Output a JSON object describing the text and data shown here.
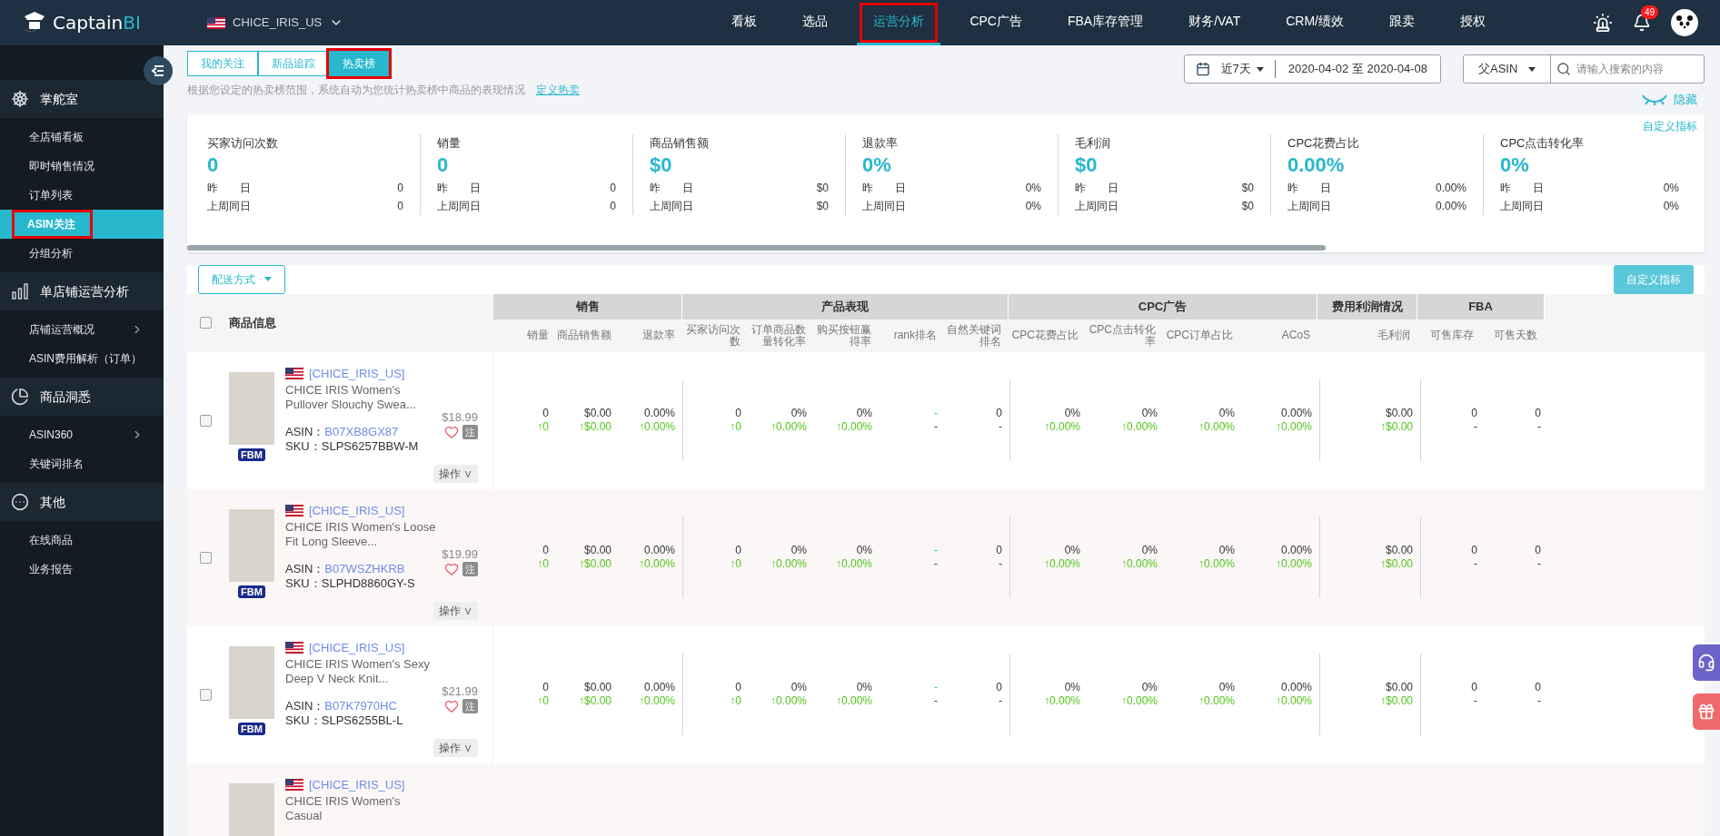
{
  "header": {
    "logo": {
      "name": "Captain",
      "accent": "BI"
    },
    "store": "CHICE_IRIS_US",
    "notification_count": "49",
    "nav": [
      {
        "label": "看板",
        "selected": false
      },
      {
        "label": "选品",
        "selected": false
      },
      {
        "label": "运营分析",
        "selected": true
      },
      {
        "label": "CPC广告",
        "selected": false
      },
      {
        "label": "FBA库存管理",
        "selected": false
      },
      {
        "label": "财务/VAT",
        "selected": false
      },
      {
        "label": "CRM/绩效",
        "selected": false
      },
      {
        "label": "跟卖",
        "selected": false
      },
      {
        "label": "授权",
        "selected": false
      }
    ]
  },
  "sidebar": {
    "sections": [
      {
        "title": "掌舵室",
        "items": [
          {
            "label": "全店铺看板",
            "selected": false,
            "has_submenu": false
          },
          {
            "label": "即时销售情况",
            "selected": false,
            "has_submenu": false
          },
          {
            "label": "订单列表",
            "selected": false,
            "has_submenu": false
          },
          {
            "label": "ASIN关注",
            "selected": true,
            "has_submenu": false
          },
          {
            "label": "分组分析",
            "selected": false,
            "has_submenu": false
          }
        ]
      },
      {
        "title": "单店铺运营分析",
        "items": [
          {
            "label": "店铺运营概况",
            "selected": false,
            "has_submenu": true
          },
          {
            "label": "ASIN费用解析（订单）",
            "selected": false,
            "has_submenu": false
          }
        ]
      },
      {
        "title": "商品洞悉",
        "items": [
          {
            "label": "ASIN360",
            "selected": false,
            "has_submenu": true
          },
          {
            "label": "关键词排名",
            "selected": false,
            "has_submenu": false
          }
        ]
      },
      {
        "title": "其他",
        "items": [
          {
            "label": "在线商品",
            "selected": false,
            "has_submenu": false
          },
          {
            "label": "业务报告",
            "selected": false,
            "has_submenu": false
          }
        ]
      }
    ]
  },
  "tabs": [
    {
      "label": "我的关注",
      "selected": false
    },
    {
      "label": "新品追踪",
      "selected": false
    },
    {
      "label": "热卖榜",
      "selected": true
    }
  ],
  "hint": "根据您设定的热卖榜范围，系统自动为您统计热卖榜中商品的表现情况",
  "hint_link": "定义热卖",
  "date_filter": {
    "preset": "近7天",
    "range": "2020-04-02 至 2020-04-08"
  },
  "search": {
    "scope": "父ASIN",
    "placeholder": "请输入搜索的内容"
  },
  "hide_label": "隐藏",
  "customize_link": "自定义指标",
  "metrics": [
    {
      "label": "买家访问次数",
      "value": "0",
      "compare": [
        {
          "label": "昨　　日",
          "value": "0"
        },
        {
          "label": "上周同日",
          "value": "0"
        }
      ]
    },
    {
      "label": "销量",
      "value": "0",
      "compare": [
        {
          "label": "昨　　日",
          "value": "0"
        },
        {
          "label": "上周同日",
          "value": "0"
        }
      ]
    },
    {
      "label": "商品销售额",
      "value": "$0",
      "compare": [
        {
          "label": "昨　　日",
          "value": "$0"
        },
        {
          "label": "上周同日",
          "value": "$0"
        }
      ]
    },
    {
      "label": "退款率",
      "value": "0%",
      "compare": [
        {
          "label": "昨　　日",
          "value": "0%"
        },
        {
          "label": "上周同日",
          "value": "0%"
        }
      ]
    },
    {
      "label": "毛利润",
      "value": "$0",
      "compare": [
        {
          "label": "昨　　日",
          "value": "$0"
        },
        {
          "label": "上周同日",
          "value": "$0"
        }
      ]
    },
    {
      "label": "CPC花费占比",
      "value": "0.00%",
      "compare": [
        {
          "label": "昨　　日",
          "value": "0.00%"
        },
        {
          "label": "上周同日",
          "value": "0.00%"
        }
      ]
    },
    {
      "label": "CPC点击转化率",
      "value": "0%",
      "compare": [
        {
          "label": "昨　　日",
          "value": "0%"
        },
        {
          "label": "上周同日",
          "value": "0%"
        }
      ]
    }
  ],
  "table": {
    "delivery_filter": "配送方式",
    "customize_button": "自定义指标",
    "select_all": false,
    "product_header": "商品信息",
    "groups": [
      {
        "label": "销售",
        "columns": [
          "销量",
          "商品销售额",
          "退款率"
        ]
      },
      {
        "label": "产品表现",
        "columns": [
          "买家访问次数",
          "订单商品数量转化率",
          "购买按钮赢得率",
          "rank排名",
          "自然关键词排名"
        ]
      },
      {
        "label": "CPC广告",
        "columns": [
          "CPC花费占比",
          "CPC点击转化率",
          "CPC订单占比",
          "ACoS"
        ]
      },
      {
        "label": "费用利润情况",
        "columns": [
          "毛利润"
        ]
      },
      {
        "label": "FBA",
        "columns": [
          "可售库存",
          "可售天数"
        ]
      }
    ],
    "rows": [
      {
        "checked": false,
        "store": "[CHICE_IRIS_US]",
        "title": "CHICE IRIS Women's Pullover Slouchy Swea...",
        "price": "$18.99",
        "asin_label": "ASIN：",
        "asin": "B07XB8GX87",
        "sku_label": "SKU：",
        "sku": "SLPS6257BBW-M",
        "fulfillment": "FBM",
        "note": "注",
        "action": "操作 ∨",
        "cells": [
          {
            "kind": "rise",
            "value": "0",
            "change": "↑0"
          },
          {
            "kind": "rise",
            "value": "$0.00",
            "change": "↑$0.00"
          },
          {
            "kind": "rise",
            "value": "0.00%",
            "change": "↑0.00%"
          },
          {
            "kind": "rise",
            "value": "0",
            "change": "↑0"
          },
          {
            "kind": "rise",
            "value": "0%",
            "change": "↑0.00%"
          },
          {
            "kind": "rise",
            "value": "0%",
            "change": "↑0.00%"
          },
          {
            "kind": "rank",
            "value": "-",
            "change": "-"
          },
          {
            "kind": "plain",
            "value": "0",
            "change": "-"
          },
          {
            "kind": "rise",
            "value": "0%",
            "change": "↑0.00%"
          },
          {
            "kind": "rise",
            "value": "0%",
            "change": "↑0.00%"
          },
          {
            "kind": "rise",
            "value": "0%",
            "change": "↑0.00%"
          },
          {
            "kind": "rise",
            "value": "0.00%",
            "change": "↑0.00%"
          },
          {
            "kind": "rise",
            "value": "$0.00",
            "change": "↑$0.00"
          },
          {
            "kind": "plain",
            "value": "0",
            "change": "-"
          },
          {
            "kind": "plain",
            "value": "0",
            "change": "-"
          }
        ]
      },
      {
        "checked": false,
        "store": "[CHICE_IRIS_US]",
        "title": "CHICE IRIS Women's Loose Fit Long Sleeve...",
        "price": "$19.99",
        "asin_label": "ASIN：",
        "asin": "B07WSZHKRB",
        "sku_label": "SKU：",
        "sku": "SLPHD8860GY-S",
        "fulfillment": "FBM",
        "note": "注",
        "action": "操作 ∨",
        "cells": [
          {
            "kind": "rise",
            "value": "0",
            "change": "↑0"
          },
          {
            "kind": "rise",
            "value": "$0.00",
            "change": "↑$0.00"
          },
          {
            "kind": "rise",
            "value": "0.00%",
            "change": "↑0.00%"
          },
          {
            "kind": "rise",
            "value": "0",
            "change": "↑0"
          },
          {
            "kind": "rise",
            "value": "0%",
            "change": "↑0.00%"
          },
          {
            "kind": "rise",
            "value": "0%",
            "change": "↑0.00%"
          },
          {
            "kind": "rank",
            "value": "-",
            "change": "-"
          },
          {
            "kind": "plain",
            "value": "0",
            "change": "-"
          },
          {
            "kind": "rise",
            "value": "0%",
            "change": "↑0.00%"
          },
          {
            "kind": "rise",
            "value": "0%",
            "change": "↑0.00%"
          },
          {
            "kind": "rise",
            "value": "0%",
            "change": "↑0.00%"
          },
          {
            "kind": "rise",
            "value": "0.00%",
            "change": "↑0.00%"
          },
          {
            "kind": "rise",
            "value": "$0.00",
            "change": "↑$0.00"
          },
          {
            "kind": "plain",
            "value": "0",
            "change": "-"
          },
          {
            "kind": "plain",
            "value": "0",
            "change": "-"
          }
        ]
      },
      {
        "checked": false,
        "store": "[CHICE_IRIS_US]",
        "title": "CHICE IRIS Women's Sexy Deep V Neck Knit...",
        "price": "$21.99",
        "asin_label": "ASIN：",
        "asin": "B07K7970HC",
        "sku_label": "SKU：",
        "sku": "SLPS6255BL-L",
        "fulfillment": "FBM",
        "note": "注",
        "action": "操作 ∨",
        "cells": [
          {
            "kind": "rise",
            "value": "0",
            "change": "↑0"
          },
          {
            "kind": "rise",
            "value": "$0.00",
            "change": "↑$0.00"
          },
          {
            "kind": "rise",
            "value": "0.00%",
            "change": "↑0.00%"
          },
          {
            "kind": "rise",
            "value": "0",
            "change": "↑0"
          },
          {
            "kind": "rise",
            "value": "0%",
            "change": "↑0.00%"
          },
          {
            "kind": "rise",
            "value": "0%",
            "change": "↑0.00%"
          },
          {
            "kind": "rank",
            "value": "-",
            "change": "-"
          },
          {
            "kind": "plain",
            "value": "0",
            "change": "-"
          },
          {
            "kind": "rise",
            "value": "0%",
            "change": "↑0.00%"
          },
          {
            "kind": "rise",
            "value": "0%",
            "change": "↑0.00%"
          },
          {
            "kind": "rise",
            "value": "0%",
            "change": "↑0.00%"
          },
          {
            "kind": "rise",
            "value": "0.00%",
            "change": "↑0.00%"
          },
          {
            "kind": "rise",
            "value": "$0.00",
            "change": "↑$0.00"
          },
          {
            "kind": "plain",
            "value": "0",
            "change": "-"
          },
          {
            "kind": "plain",
            "value": "0",
            "change": "-"
          }
        ]
      },
      {
        "store": "[CHICE_IRIS_US]",
        "title": "CHICE IRIS Women's Casual"
      }
    ]
  }
}
